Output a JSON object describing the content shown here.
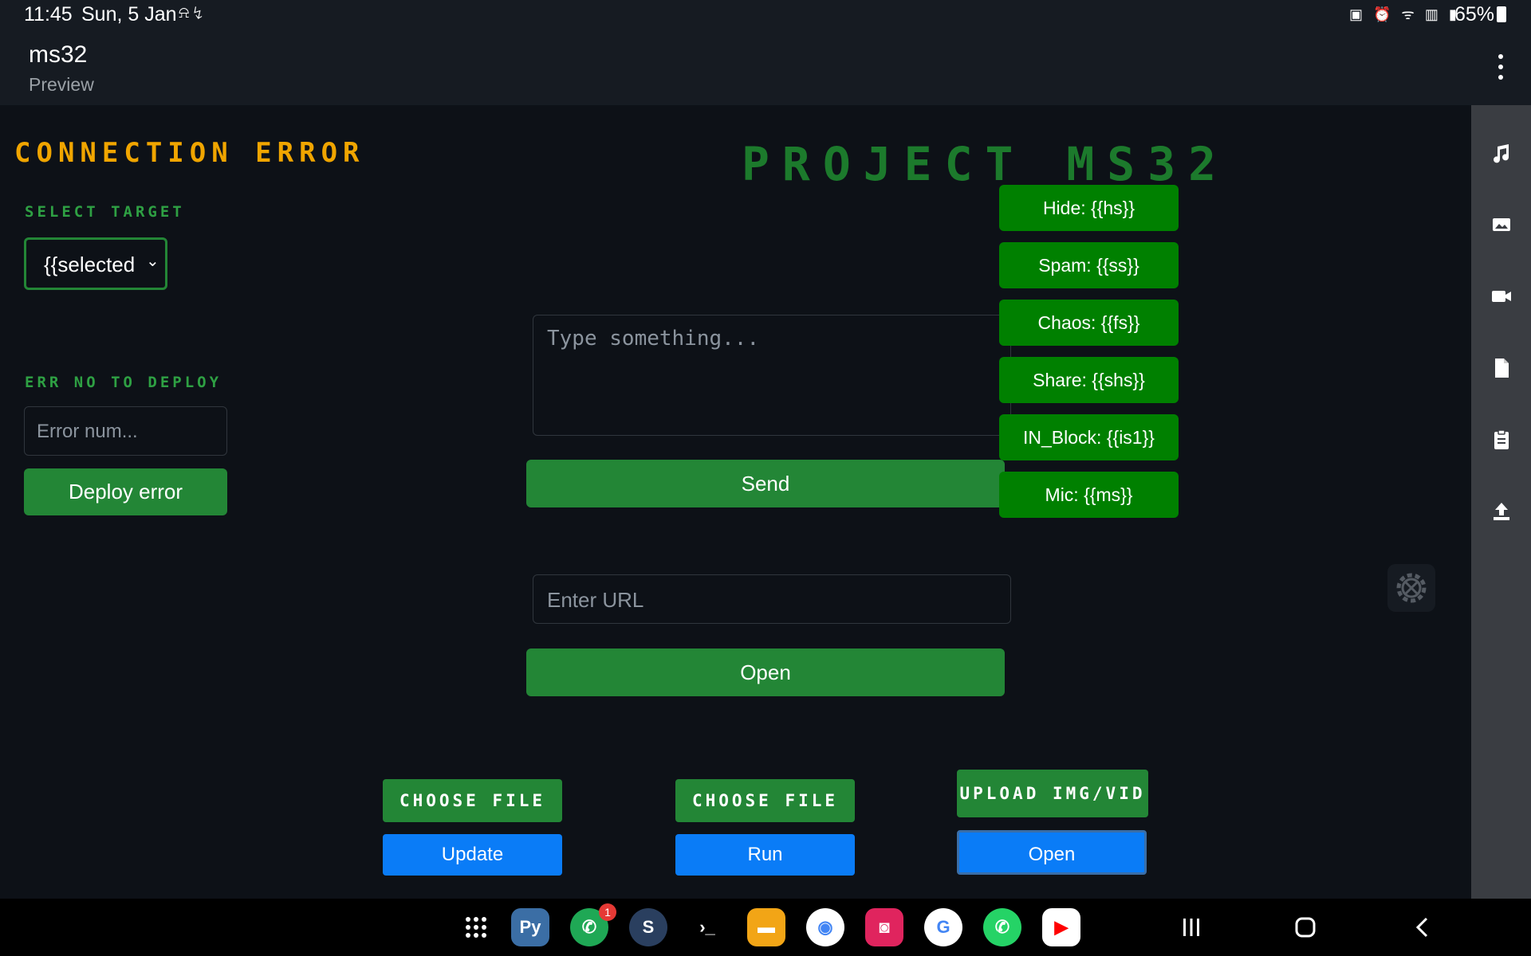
{
  "status_bar": {
    "time": "11:45",
    "date": "Sun, 5 Jan",
    "left_icons": "⍾ ↯",
    "right_icons": "▣ ⏰ ᯤ ▥ ▮",
    "battery": "65%"
  },
  "header": {
    "title": "ms32",
    "subtitle": "Preview"
  },
  "main": {
    "connection_error": "CONNECTION ERROR",
    "select_label": "SELECT TARGET",
    "select_value": "{{selected",
    "err_label": "ERR NO TO DEPLOY",
    "err_placeholder": "Error num...",
    "deploy_label": "Deploy error",
    "project_title": "PROJECT MS32",
    "message_placeholder": "Type something...",
    "send_label": "Send",
    "toggles": [
      "Hide: {{hs}}",
      "Spam: {{ss}}",
      "Chaos: {{fs}}",
      "Share: {{shs}}",
      "IN_Block: {{is1}}",
      "Mic: {{ms}}"
    ],
    "url_placeholder": "Enter URL",
    "open_url_label": "Open",
    "file_pickers": [
      {
        "choose": "CHOOSE FILE",
        "action": "Update"
      },
      {
        "choose": "CHOOSE FILE",
        "action": "Run"
      },
      {
        "choose": "UPLOAD IMG/VID",
        "action": "Open"
      }
    ]
  },
  "rail": {
    "icons": [
      "music-icon",
      "image-icon",
      "video-icon",
      "file-icon",
      "clipboard-icon",
      "upload-icon"
    ]
  },
  "dock": {
    "apps": [
      {
        "name": "pydroid",
        "glyph": "Py",
        "color": "#3b6ea5"
      },
      {
        "name": "phone",
        "glyph": "✆",
        "color": "#1fa855",
        "badge": "1"
      },
      {
        "name": "shield-app",
        "glyph": "S",
        "color": "#2a3f5f"
      },
      {
        "name": "terminal",
        "glyph": "›_",
        "color": "#000000"
      },
      {
        "name": "files",
        "glyph": "▬",
        "color": "#f2a516"
      },
      {
        "name": "chrome",
        "glyph": "◉",
        "color": "#ffffff"
      },
      {
        "name": "screen-recorder",
        "glyph": "◙",
        "color": "#e0245e"
      },
      {
        "name": "google",
        "glyph": "G",
        "color": "#ffffff"
      },
      {
        "name": "whatsapp",
        "glyph": "✆",
        "color": "#25d366"
      },
      {
        "name": "youtube",
        "glyph": "▶",
        "color": "#ffffff"
      }
    ]
  },
  "colors": {
    "accent_green": "#238636",
    "toggle_green": "#008000",
    "action_blue": "#0a7cf7",
    "error_orange": "#f0a500"
  }
}
